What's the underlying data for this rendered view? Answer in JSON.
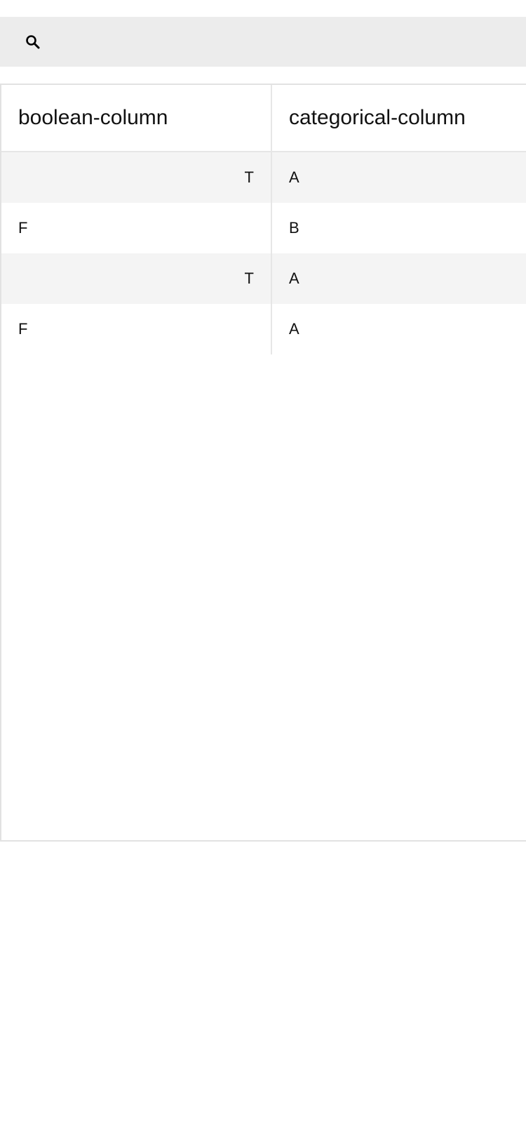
{
  "search": {
    "icon": "search-icon",
    "placeholder": "",
    "value": ""
  },
  "table": {
    "columns": [
      "boolean-column",
      "categorical-column"
    ],
    "rows": [
      [
        "T",
        "A"
      ],
      [
        "F",
        "B"
      ],
      [
        "T",
        "A"
      ],
      [
        "F",
        "A"
      ]
    ]
  },
  "colors": {
    "search_bg": "#ececec",
    "stripe_bg": "#f4f4f4",
    "border": "#e2e2e2"
  }
}
